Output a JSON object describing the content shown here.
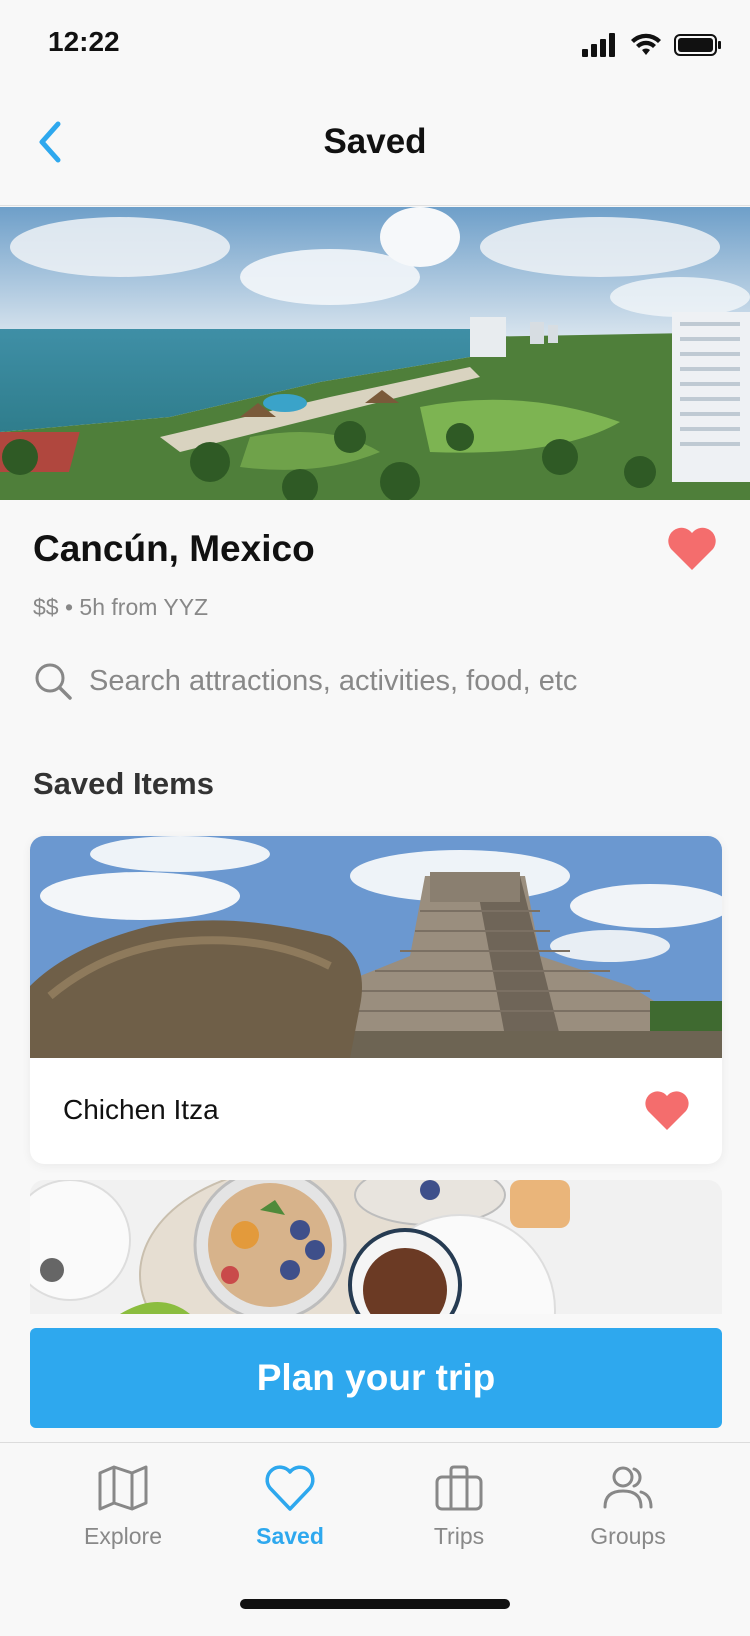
{
  "status_bar": {
    "time": "12:22"
  },
  "header": {
    "title": "Saved",
    "back_icon": "chevron-left-icon"
  },
  "destination": {
    "name": "Cancún, Mexico",
    "meta": "$$ • 5h from YYZ",
    "favorited": true
  },
  "search": {
    "placeholder": "Search attractions, activities, food, etc"
  },
  "saved_section": {
    "title": "Saved Items",
    "items": [
      {
        "title": "Chichen Itza",
        "favorited": true
      }
    ]
  },
  "cta": {
    "label": "Plan your trip"
  },
  "tab_bar": {
    "tabs": [
      {
        "label": "Explore",
        "icon": "map-icon",
        "active": false
      },
      {
        "label": "Saved",
        "icon": "heart-icon",
        "active": true
      },
      {
        "label": "Trips",
        "icon": "briefcase-icon",
        "active": false
      },
      {
        "label": "Groups",
        "icon": "users-icon",
        "active": false
      }
    ]
  },
  "colors": {
    "accent": "#2ea8ee",
    "heart": "#f46d6d",
    "muted": "#888888"
  }
}
